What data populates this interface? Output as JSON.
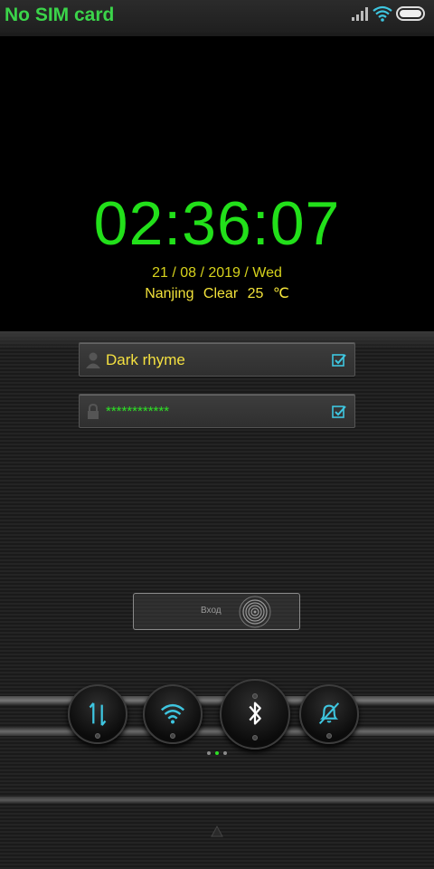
{
  "status_bar": {
    "carrier": "No SIM card",
    "icons": [
      "signal-icon",
      "wifi-icon",
      "battery-icon"
    ]
  },
  "clock": {
    "time": "02:36:07",
    "date": "21 / 08 / 2019 / Wed",
    "weather": "Nanjing  Clear  25 ℃"
  },
  "login": {
    "username": "Dark rhyme",
    "password": "************",
    "button_label": "Вход"
  },
  "toggles": [
    "data-transfer-icon",
    "wifi-icon",
    "bluetooth-icon",
    "silent-mode-icon"
  ],
  "pager": {
    "pages": 3,
    "current": 2
  },
  "colors": {
    "accent_green": "#22e01a",
    "accent_yellow": "#f2e23a",
    "accent_cyan": "#3ec6e0"
  }
}
